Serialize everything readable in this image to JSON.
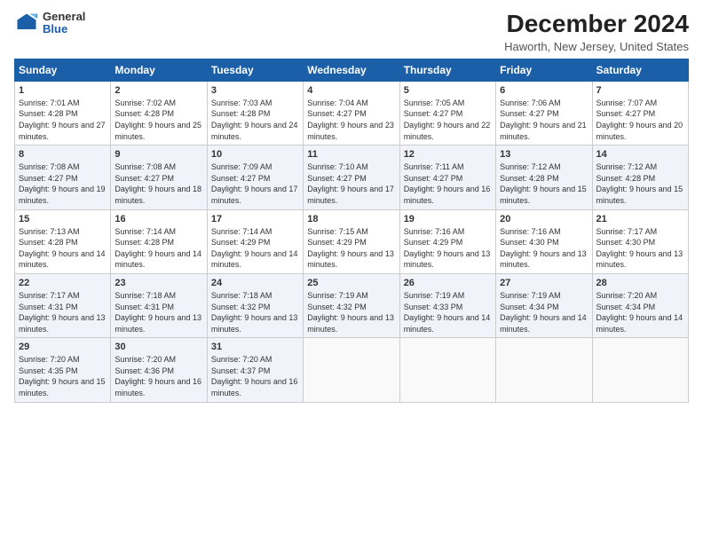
{
  "header": {
    "logo_general": "General",
    "logo_blue": "Blue",
    "title": "December 2024",
    "subtitle": "Haworth, New Jersey, United States"
  },
  "days": [
    "Sunday",
    "Monday",
    "Tuesday",
    "Wednesday",
    "Thursday",
    "Friday",
    "Saturday"
  ],
  "weeks": [
    [
      {
        "num": "1",
        "sunrise": "7:01 AM",
        "sunset": "4:28 PM",
        "daylight": "9 hours and 27 minutes."
      },
      {
        "num": "2",
        "sunrise": "7:02 AM",
        "sunset": "4:28 PM",
        "daylight": "9 hours and 25 minutes."
      },
      {
        "num": "3",
        "sunrise": "7:03 AM",
        "sunset": "4:28 PM",
        "daylight": "9 hours and 24 minutes."
      },
      {
        "num": "4",
        "sunrise": "7:04 AM",
        "sunset": "4:27 PM",
        "daylight": "9 hours and 23 minutes."
      },
      {
        "num": "5",
        "sunrise": "7:05 AM",
        "sunset": "4:27 PM",
        "daylight": "9 hours and 22 minutes."
      },
      {
        "num": "6",
        "sunrise": "7:06 AM",
        "sunset": "4:27 PM",
        "daylight": "9 hours and 21 minutes."
      },
      {
        "num": "7",
        "sunrise": "7:07 AM",
        "sunset": "4:27 PM",
        "daylight": "9 hours and 20 minutes."
      }
    ],
    [
      {
        "num": "8",
        "sunrise": "7:08 AM",
        "sunset": "4:27 PM",
        "daylight": "9 hours and 19 minutes."
      },
      {
        "num": "9",
        "sunrise": "7:08 AM",
        "sunset": "4:27 PM",
        "daylight": "9 hours and 18 minutes."
      },
      {
        "num": "10",
        "sunrise": "7:09 AM",
        "sunset": "4:27 PM",
        "daylight": "9 hours and 17 minutes."
      },
      {
        "num": "11",
        "sunrise": "7:10 AM",
        "sunset": "4:27 PM",
        "daylight": "9 hours and 17 minutes."
      },
      {
        "num": "12",
        "sunrise": "7:11 AM",
        "sunset": "4:27 PM",
        "daylight": "9 hours and 16 minutes."
      },
      {
        "num": "13",
        "sunrise": "7:12 AM",
        "sunset": "4:28 PM",
        "daylight": "9 hours and 15 minutes."
      },
      {
        "num": "14",
        "sunrise": "7:12 AM",
        "sunset": "4:28 PM",
        "daylight": "9 hours and 15 minutes."
      }
    ],
    [
      {
        "num": "15",
        "sunrise": "7:13 AM",
        "sunset": "4:28 PM",
        "daylight": "9 hours and 14 minutes."
      },
      {
        "num": "16",
        "sunrise": "7:14 AM",
        "sunset": "4:28 PM",
        "daylight": "9 hours and 14 minutes."
      },
      {
        "num": "17",
        "sunrise": "7:14 AM",
        "sunset": "4:29 PM",
        "daylight": "9 hours and 14 minutes."
      },
      {
        "num": "18",
        "sunrise": "7:15 AM",
        "sunset": "4:29 PM",
        "daylight": "9 hours and 13 minutes."
      },
      {
        "num": "19",
        "sunrise": "7:16 AM",
        "sunset": "4:29 PM",
        "daylight": "9 hours and 13 minutes."
      },
      {
        "num": "20",
        "sunrise": "7:16 AM",
        "sunset": "4:30 PM",
        "daylight": "9 hours and 13 minutes."
      },
      {
        "num": "21",
        "sunrise": "7:17 AM",
        "sunset": "4:30 PM",
        "daylight": "9 hours and 13 minutes."
      }
    ],
    [
      {
        "num": "22",
        "sunrise": "7:17 AM",
        "sunset": "4:31 PM",
        "daylight": "9 hours and 13 minutes."
      },
      {
        "num": "23",
        "sunrise": "7:18 AM",
        "sunset": "4:31 PM",
        "daylight": "9 hours and 13 minutes."
      },
      {
        "num": "24",
        "sunrise": "7:18 AM",
        "sunset": "4:32 PM",
        "daylight": "9 hours and 13 minutes."
      },
      {
        "num": "25",
        "sunrise": "7:19 AM",
        "sunset": "4:32 PM",
        "daylight": "9 hours and 13 minutes."
      },
      {
        "num": "26",
        "sunrise": "7:19 AM",
        "sunset": "4:33 PM",
        "daylight": "9 hours and 14 minutes."
      },
      {
        "num": "27",
        "sunrise": "7:19 AM",
        "sunset": "4:34 PM",
        "daylight": "9 hours and 14 minutes."
      },
      {
        "num": "28",
        "sunrise": "7:20 AM",
        "sunset": "4:34 PM",
        "daylight": "9 hours and 14 minutes."
      }
    ],
    [
      {
        "num": "29",
        "sunrise": "7:20 AM",
        "sunset": "4:35 PM",
        "daylight": "9 hours and 15 minutes."
      },
      {
        "num": "30",
        "sunrise": "7:20 AM",
        "sunset": "4:36 PM",
        "daylight": "9 hours and 16 minutes."
      },
      {
        "num": "31",
        "sunrise": "7:20 AM",
        "sunset": "4:37 PM",
        "daylight": "9 hours and 16 minutes."
      },
      null,
      null,
      null,
      null
    ]
  ],
  "labels": {
    "sunrise": "Sunrise:",
    "sunset": "Sunset:",
    "daylight": "Daylight:"
  }
}
